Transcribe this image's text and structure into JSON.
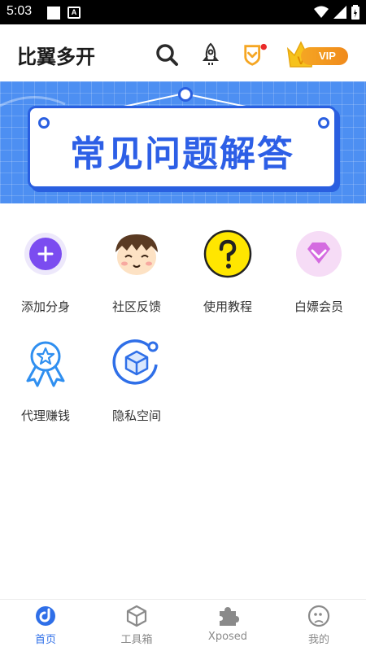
{
  "status_bar": {
    "time": "5:03",
    "a_icon_label": "A"
  },
  "header": {
    "title": "比翼多开",
    "icons": [
      "search-icon",
      "rocket-icon",
      "shield-badge-icon"
    ],
    "vip_label": "VIP",
    "vip_mark": "V"
  },
  "banner": {
    "title": "常见问题解答"
  },
  "features": [
    {
      "label": "添加分身",
      "icon": "add-circle-icon"
    },
    {
      "label": "社区反馈",
      "icon": "cartoon-face-icon"
    },
    {
      "label": "使用教程",
      "icon": "question-mark-icon"
    },
    {
      "label": "白嫖会员",
      "icon": "diamond-icon"
    },
    {
      "label": "代理赚钱",
      "icon": "award-ribbon-icon"
    },
    {
      "label": "隐私空间",
      "icon": "privacy-cube-icon"
    }
  ],
  "bottom_nav": [
    {
      "label": "首页",
      "icon": "home-icon",
      "active": true
    },
    {
      "label": "工具箱",
      "icon": "cube-icon",
      "active": false
    },
    {
      "label": "Xposed",
      "icon": "puzzle-icon",
      "active": false
    },
    {
      "label": "我的",
      "icon": "face-icon",
      "active": false
    }
  ],
  "colors": {
    "accent": "#2f6fe8",
    "banner": "#4d8ff2",
    "vip": "#f5a623"
  }
}
